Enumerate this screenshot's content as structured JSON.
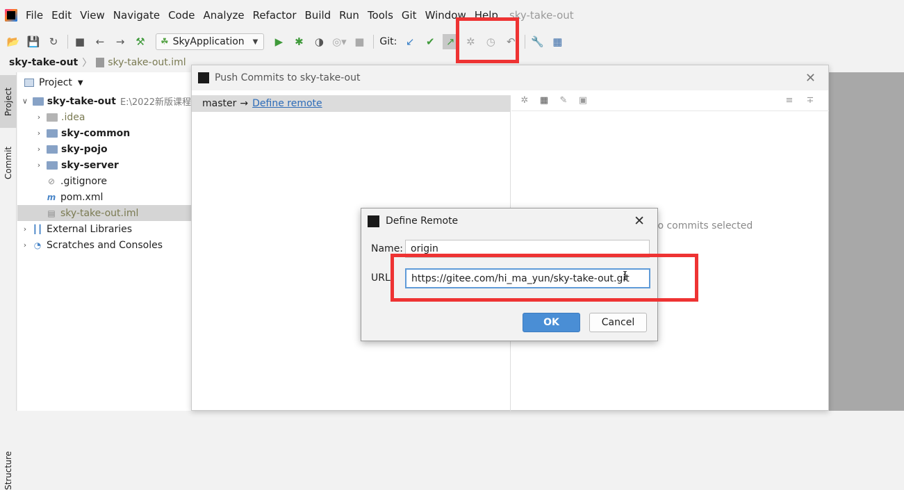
{
  "menubar": {
    "items": [
      "File",
      "Edit",
      "View",
      "Navigate",
      "Code",
      "Analyze",
      "Refactor",
      "Build",
      "Run",
      "Tools",
      "Git",
      "Window",
      "Help"
    ],
    "project_title": "sky-take-out"
  },
  "toolbar": {
    "run_config": "SkyApplication",
    "git_label": "Git:"
  },
  "breadcrumb": {
    "root": "sky-take-out",
    "file": "sky-take-out.iml"
  },
  "side_stripe": {
    "project": "Project",
    "commit": "Commit",
    "structure": "Structure"
  },
  "project_panel": {
    "header": "Project",
    "root": {
      "name": "sky-take-out",
      "path": "E:\\2022新版课程"
    },
    "items": [
      {
        "name": ".idea"
      },
      {
        "name": "sky-common"
      },
      {
        "name": "sky-pojo"
      },
      {
        "name": "sky-server"
      },
      {
        "name": ".gitignore"
      },
      {
        "name": "pom.xml"
      },
      {
        "name": "sky-take-out.iml"
      },
      {
        "name": "External Libraries"
      },
      {
        "name": "Scratches and Consoles"
      }
    ]
  },
  "push_dialog": {
    "title": "Push Commits to sky-take-out",
    "branch": "master",
    "arrow": "→",
    "define_remote_link": "Define remote",
    "no_commits": "No commits selected"
  },
  "define_remote": {
    "title": "Define Remote",
    "name_label": "Name:",
    "name_value": "origin",
    "url_label": "URL:",
    "url_value": "https://gitee.com/hi_ma_yun/sky-take-out.git",
    "ok_label": "OK",
    "cancel_label": "Cancel"
  },
  "colors": {
    "highlight": "#ee3333",
    "ok_button": "#4a8ed5",
    "link": "#2c6bb8"
  }
}
